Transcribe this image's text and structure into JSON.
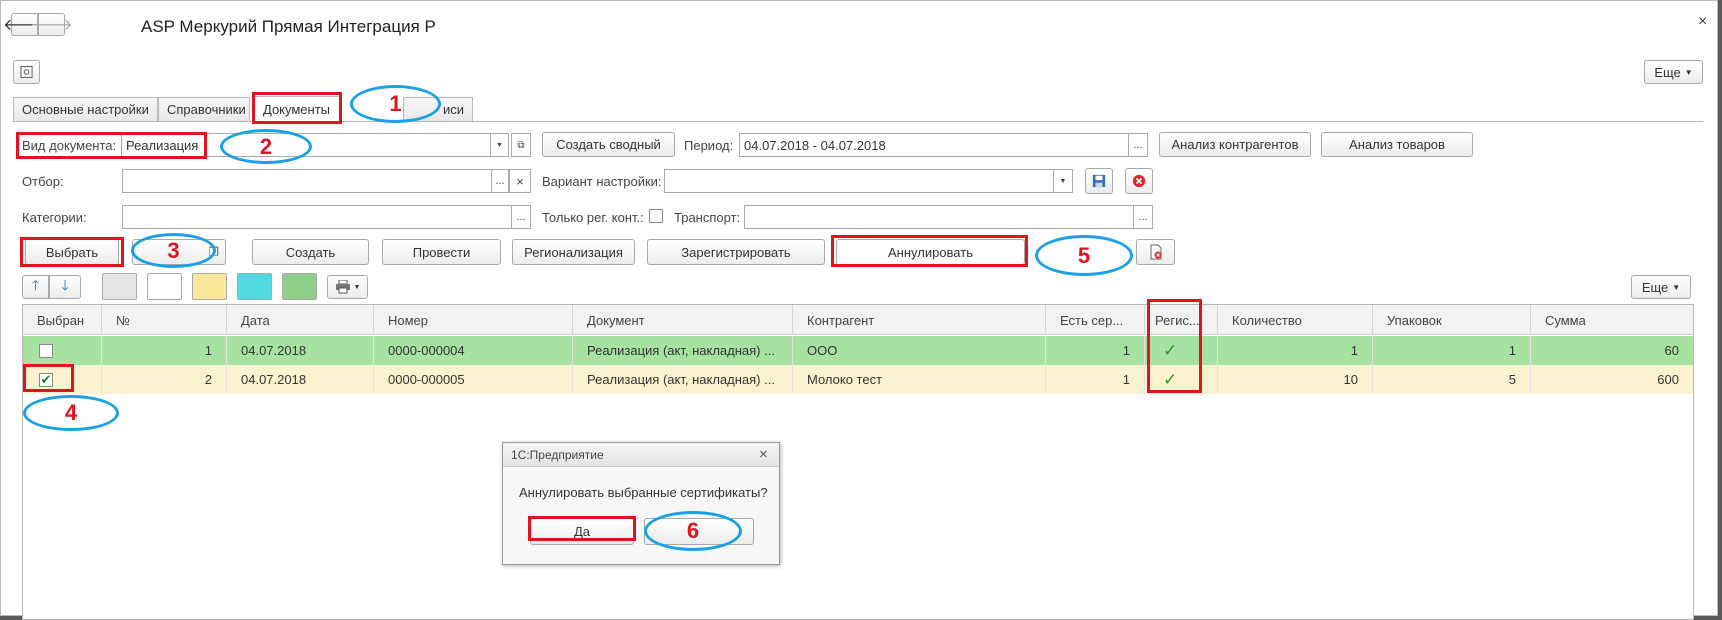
{
  "window": {
    "title": "ASP Меркурий Прямая Интеграция Р",
    "more_label": "Еще",
    "back_icon": "arrow-left-icon",
    "forward_icon": "arrow-right-icon",
    "close_glyph": "×"
  },
  "tabs": [
    {
      "label": "Основные настройки"
    },
    {
      "label": "Справочники"
    },
    {
      "label": "Документы"
    },
    {
      "label": "иси"
    }
  ],
  "filters": {
    "doc_type_label": "Вид документа:",
    "doc_type_value": "Реализация",
    "create_summary": "Создать сводный",
    "period_label": "Период:",
    "period_value": "04.07.2018 - 04.07.2018",
    "analyze_contractors": "Анализ контрагентов",
    "analyze_goods": "Анализ товаров",
    "filter_label": "Отбор:",
    "variant_label": "Вариант настройки:",
    "categories_label": "Категории:",
    "only_reg_label": "Только рег. конт.:",
    "transport_label": "Транспорт:",
    "ellipsis": "...",
    "clear_glyph": "×"
  },
  "actions": {
    "select": "Выбрать",
    "create": "Создать",
    "post": "Провести",
    "regionalize": "Регионализация",
    "register": "Зарегистрировать",
    "annul": "Аннулировать",
    "more": "Еще"
  },
  "table": {
    "headers": [
      "Выбран",
      "№",
      "Дата",
      "Номер",
      "Документ",
      "Контрагент",
      "Есть сер...",
      "Регис...",
      "Количество",
      "Упаковок",
      "Сумма"
    ],
    "rows": [
      {
        "selected": false,
        "n": "1",
        "date": "04.07.2018",
        "number": "0000-000004",
        "document": "Реализация (акт, накладная) ...",
        "contractor": "ООО",
        "has_cert": "1",
        "qty": "1",
        "packs": "1",
        "sum": "60"
      },
      {
        "selected": true,
        "n": "2",
        "date": "04.07.2018",
        "number": "0000-000005",
        "document": "Реализация (акт, накладная) ...",
        "contractor": "Молоко тест",
        "has_cert": "1",
        "qty": "10",
        "packs": "5",
        "sum": "600"
      }
    ]
  },
  "dialog": {
    "title": "1С:Предприятие",
    "message": "Аннулировать выбранные сертификаты?",
    "yes": "Да",
    "close_glyph": "×"
  },
  "annotations": [
    "1",
    "2",
    "3",
    "4",
    "5",
    "6"
  ],
  "colors": {
    "row_green": "#a8e2a2",
    "row_yellow": "#fbf3cf",
    "highlight_red": "#e0141e",
    "ellipse_blue": "#1aa0e6",
    "swatch_gray": "#e6e6e6",
    "swatch_white": "#ffffff",
    "swatch_yellow": "#fbe79a",
    "swatch_cyan": "#4fd9e0",
    "swatch_green": "#8fcf8a"
  }
}
